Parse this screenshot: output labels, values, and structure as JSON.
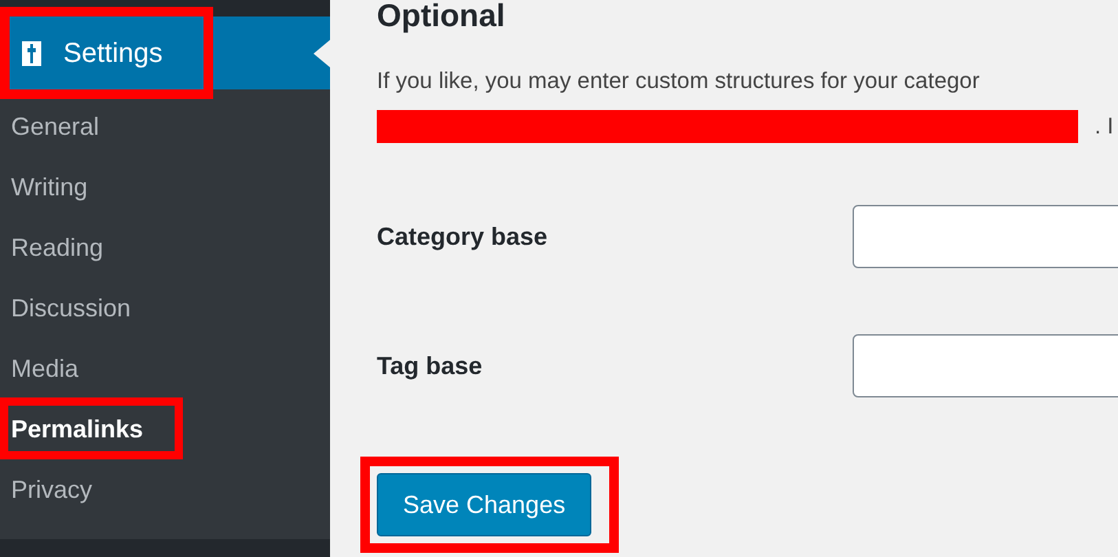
{
  "sidebar": {
    "menu": {
      "label": "Settings",
      "selected": true,
      "highlighted": true
    },
    "items": [
      {
        "label": "General",
        "selected": false,
        "highlighted": false
      },
      {
        "label": "Writing",
        "selected": false,
        "highlighted": false
      },
      {
        "label": "Reading",
        "selected": false,
        "highlighted": false
      },
      {
        "label": "Discussion",
        "selected": false,
        "highlighted": false
      },
      {
        "label": "Media",
        "selected": false,
        "highlighted": false
      },
      {
        "label": "Permalinks",
        "selected": true,
        "highlighted": true
      },
      {
        "label": "Privacy",
        "selected": false,
        "highlighted": false
      }
    ]
  },
  "main": {
    "heading": "Optional",
    "description": {
      "line_1": "If you like, you may enter custom structures for your categor",
      "redacted": true,
      "line_2_tail": ". I"
    },
    "fields": [
      {
        "label": "Category base"
      },
      {
        "label": "Tag base"
      }
    ],
    "save_button": {
      "label": "Save Changes",
      "highlighted": true
    }
  }
}
